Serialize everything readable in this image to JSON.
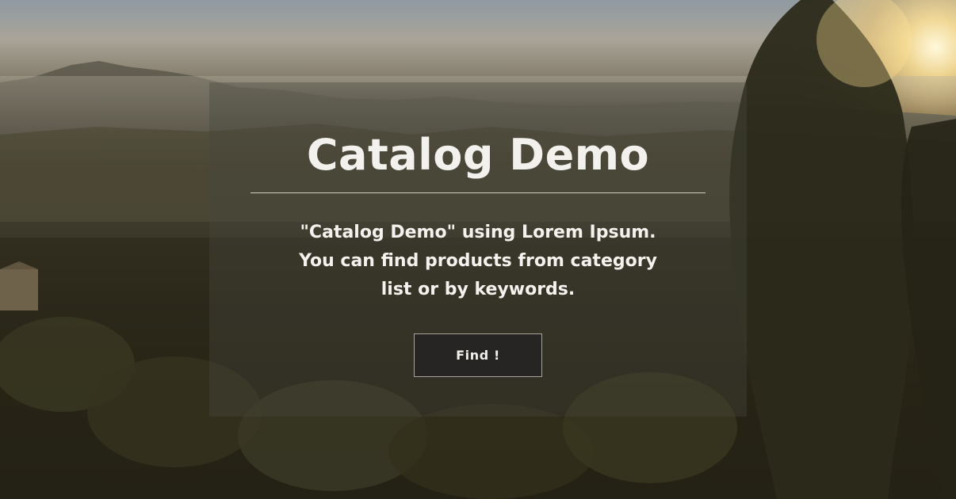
{
  "hero": {
    "title": "Catalog Demo",
    "description_lines": [
      "\"Catalog Demo\" using Lorem Ipsum.",
      "You can find products from category",
      "list or by keywords."
    ],
    "find_button_label": "Find !"
  },
  "colors": {
    "title_text": "#f2f1ee",
    "button_background": "#262524",
    "button_text": "#f1f0ec"
  }
}
